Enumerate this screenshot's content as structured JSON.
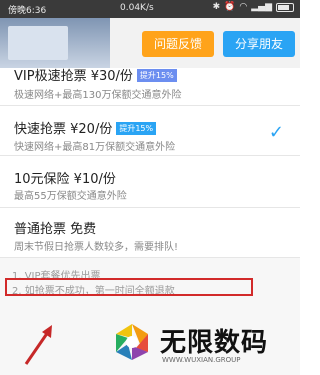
{
  "status_bar": {
    "time": "傍晚6:36",
    "speed": "0.04K/s",
    "battery_percent": 70
  },
  "toolbar": {
    "feedback_label": "问题反馈",
    "share_label": "分享朋友"
  },
  "options": [
    {
      "title": "VIP极速抢票  ¥30/份",
      "badge": "提升15%",
      "desc": "极速网络+最高130万保额交通意外险",
      "selected": false
    },
    {
      "title": "快速抢票  ¥20/份",
      "badge": "提升15%",
      "desc": "快速网络+最高81万保额交通意外险",
      "selected": true
    },
    {
      "title": "10元保险  ¥10/份",
      "badge": "",
      "desc": "最高55万保额交通意外险",
      "selected": false
    },
    {
      "title": "普通抢票  免费",
      "badge": "",
      "desc": "周末节假日抢票人数较多，需要排队!",
      "selected": false
    }
  ],
  "notes": [
    "1. VIP套餐优先出票",
    "2. 如抢票不成功，第一时间全额退款"
  ],
  "watermark": {
    "brand": "无限数码",
    "url": "WWW.WUXIAN.GROUP"
  },
  "colors": {
    "accent_blue": "#2aa4f4",
    "accent_orange": "#ffa31a",
    "highlight_red": "#d22a2a"
  }
}
